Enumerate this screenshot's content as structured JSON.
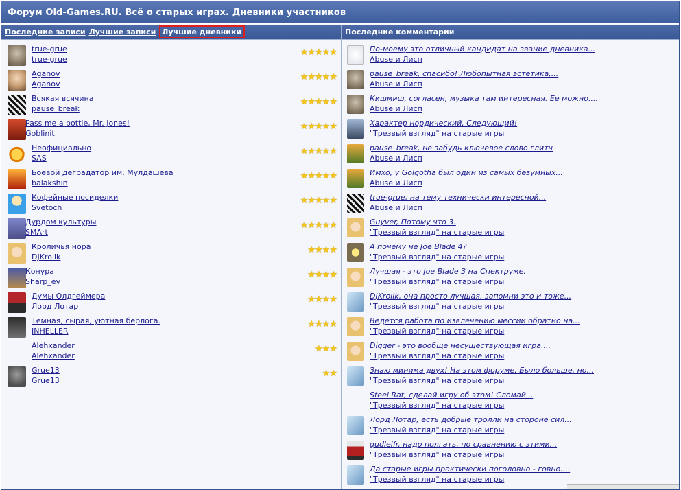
{
  "title": "Форум Old-Games.RU. Всё о старых играх. Дневники участников",
  "left_tabs": [
    "Последние записи",
    "Лучшие записи",
    "Лучшие дневники"
  ],
  "active_tab": "Лучшие дневники",
  "right_header": "Последние комментарии",
  "diaries": [
    {
      "title": "true-grue",
      "author": "true-grue",
      "stars": 5,
      "avatar": "gray"
    },
    {
      "title": "Aganov",
      "author": "Aganov",
      "stars": 5,
      "avatar": "face"
    },
    {
      "title": "Всякая всячина",
      "author": "pause_break",
      "stars": 5,
      "avatar": "bw"
    },
    {
      "title": "Pass me a bottle, Mr. Jones!",
      "author": "Goblinit",
      "stars": 5,
      "avatar": "red"
    },
    {
      "title": "Неофициально",
      "author": "SAS",
      "stars": 5,
      "avatar": "sun"
    },
    {
      "title": "Боевой деградатор им. Мулдашева",
      "author": "balakshin",
      "stars": 5,
      "avatar": "fire"
    },
    {
      "title": "Кофейные посиделки",
      "author": "Svetoch",
      "stars": 5,
      "avatar": "blue"
    },
    {
      "title": "Дурдом культуры",
      "author": "SMArt",
      "stars": 5,
      "avatar": "wizard"
    },
    {
      "title": "Кроличья нора",
      "author": "DJKrolik",
      "stars": 4,
      "avatar": "girl"
    },
    {
      "title": "Конура",
      "author": "Sharp_ey",
      "stars": 4,
      "avatar": "sharp"
    },
    {
      "title": "Думы Олдгеймера",
      "author": "Лорд Лотар",
      "stars": 4,
      "avatar": "red-warrior"
    },
    {
      "title": "Тёмная, сырая, уютная берлога.",
      "author": "INHELLER",
      "stars": 4,
      "avatar": "dark"
    },
    {
      "title": "Alehxander",
      "author": "Alehxander",
      "stars": 3,
      "avatar": "none"
    },
    {
      "title": "Grue13",
      "author": "Grue13",
      "stars": 2,
      "avatar": "cat"
    }
  ],
  "comments": [
    {
      "text": "По-моему это отличный кандидат на звание дневника...",
      "diary": "Abuse и Лисп",
      "avatar": "gnome"
    },
    {
      "text": "pause_break, спасибо! Любопытная эстетика,...",
      "diary": "Abuse и Лисп",
      "avatar": "gray"
    },
    {
      "text": "Кишмиш, согласен, музыка там интересная. Ее можно....",
      "diary": "Abuse и Лисп",
      "avatar": "gray"
    },
    {
      "text": "Характер нордический. Следующий!",
      "diary": "\"Трезвый взгляд\" на старые игры",
      "avatar": "knight"
    },
    {
      "text": "pause_break, не забудь ключевое слово глитч",
      "diary": "Abuse и Лисп",
      "avatar": "creature"
    },
    {
      "text": "Имхо, у Golgotha был один из самых безумных...",
      "diary": "Abuse и Лисп",
      "avatar": "creature"
    },
    {
      "text": "true-grue, на тему технически интересной...",
      "diary": "Abuse и Лисп",
      "avatar": "bw"
    },
    {
      "text": "Guyver, Потому что 3.",
      "diary": "\"Трезвый взгляд\" на старые игры",
      "avatar": "girl"
    },
    {
      "text": "А почему не Joe Blade 4?",
      "diary": "\"Трезвый взгляд\" на старые игры",
      "avatar": "camera"
    },
    {
      "text": "Лучшая - это Joe Blade 3 на Спектруме.",
      "diary": "\"Трезвый взгляд\" на старые игры",
      "avatar": "girl"
    },
    {
      "text": "DJKrolik, она просто лучшая, запомни это и тоже...",
      "diary": "\"Трезвый взгляд\" на старые игры",
      "avatar": "dragon"
    },
    {
      "text": "Ведется работа по извлечению мессии обратно на...",
      "diary": "\"Трезвый взгляд\" на старые игры",
      "avatar": "girl"
    },
    {
      "text": "Digger - это вообще несуществующая игра....",
      "diary": "\"Трезвый взгляд\" на старые игры",
      "avatar": "girl"
    },
    {
      "text": "Знаю минима двух! На этом форуме. Было больше, но...",
      "diary": "\"Трезвый взгляд\" на старые игры",
      "avatar": "dragon"
    },
    {
      "text": "Steel Rat, сделай игру об этом! Сломай...",
      "diary": "\"Трезвый взгляд\" на старые игры",
      "avatar": "none"
    },
    {
      "text": "Лорд Лотар, есть добрые тролли на стороне сил...",
      "diary": "\"Трезвый взгляд\" на старые игры",
      "avatar": "dragon"
    },
    {
      "text": "gudleifr, надо полгать, по сравнению с этими...",
      "diary": "\"Трезвый взгляд\" на старые игры",
      "avatar": "redfig"
    },
    {
      "text": "Да старые игры практически поголовно - говно....",
      "diary": "\"Трезвый взгляд\" на старые игры",
      "avatar": "dragon"
    }
  ]
}
